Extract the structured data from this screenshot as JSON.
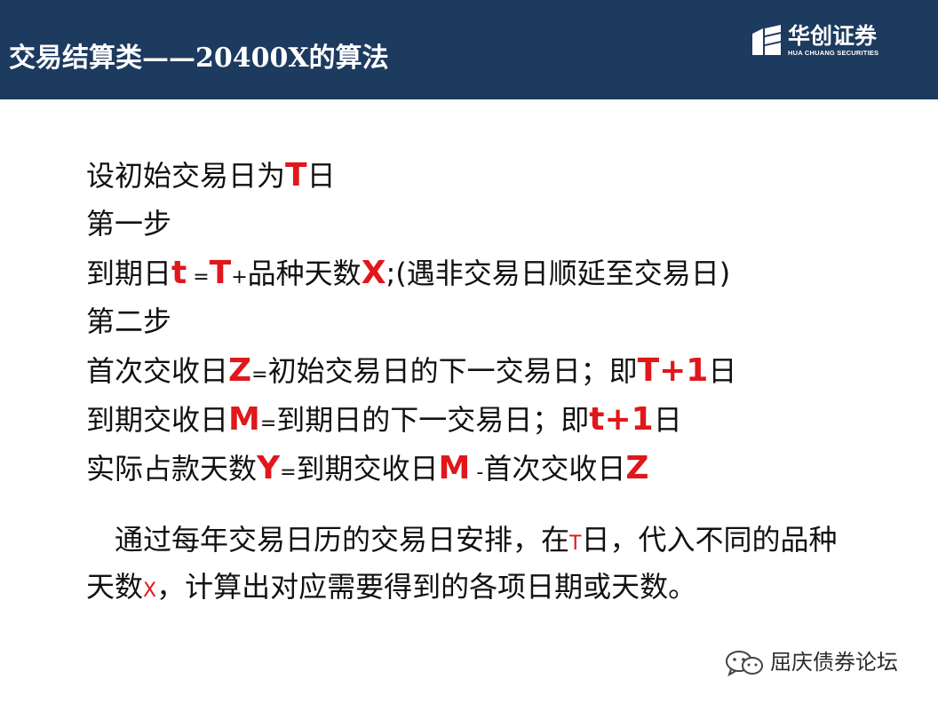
{
  "header": {
    "title_cn": "交易结算类",
    "title_rest": "——20400X",
    "title_tail": "的算法"
  },
  "logo": {
    "cn": "华创证券",
    "en": "HUA CHUANG SECURITIES"
  },
  "lines": {
    "l1": {
      "a": "设初始交易日为",
      "var": "T",
      "b": "日"
    },
    "l2": {
      "a": "第一步"
    },
    "l3": {
      "a": "到期日",
      "var1": "t",
      "eq": " =",
      "var2": "T",
      "plus": "+",
      "b": "品种天数",
      "var3": "X",
      "c": ";(遇非交易日顺延至交易日)"
    },
    "l4": {
      "a": "第二步"
    },
    "l5": {
      "a": "首次交收日",
      "var": "Z",
      "eq": "=",
      "b": "初始交易日的下一交易日；即",
      "var2": "T+1",
      "c": "日"
    },
    "l6": {
      "a": "到期交收日",
      "var": "M",
      "eq": "=",
      "b": "到期日的下一交易日；即",
      "var2": "t+1",
      "c": "日"
    },
    "l7": {
      "a": "实际占款天数",
      "var": "Y",
      "eq": "=",
      "b": "到期交收日",
      "var2": "M",
      "sp": " -",
      "c": "首次交收日",
      "var3": "Z"
    }
  },
  "paragraph": {
    "a": "　通过每年交易日历的交易日安排，在",
    "t": "T",
    "b": "日，代入不同的品种天数",
    "x": "X",
    "c": "，计算出对应需要得到的各项日期或天数。"
  },
  "watermark": {
    "text": "屈庆债券论坛"
  },
  "colors": {
    "header_bg": "#1d3a5f",
    "accent_red": "#e0171b"
  }
}
